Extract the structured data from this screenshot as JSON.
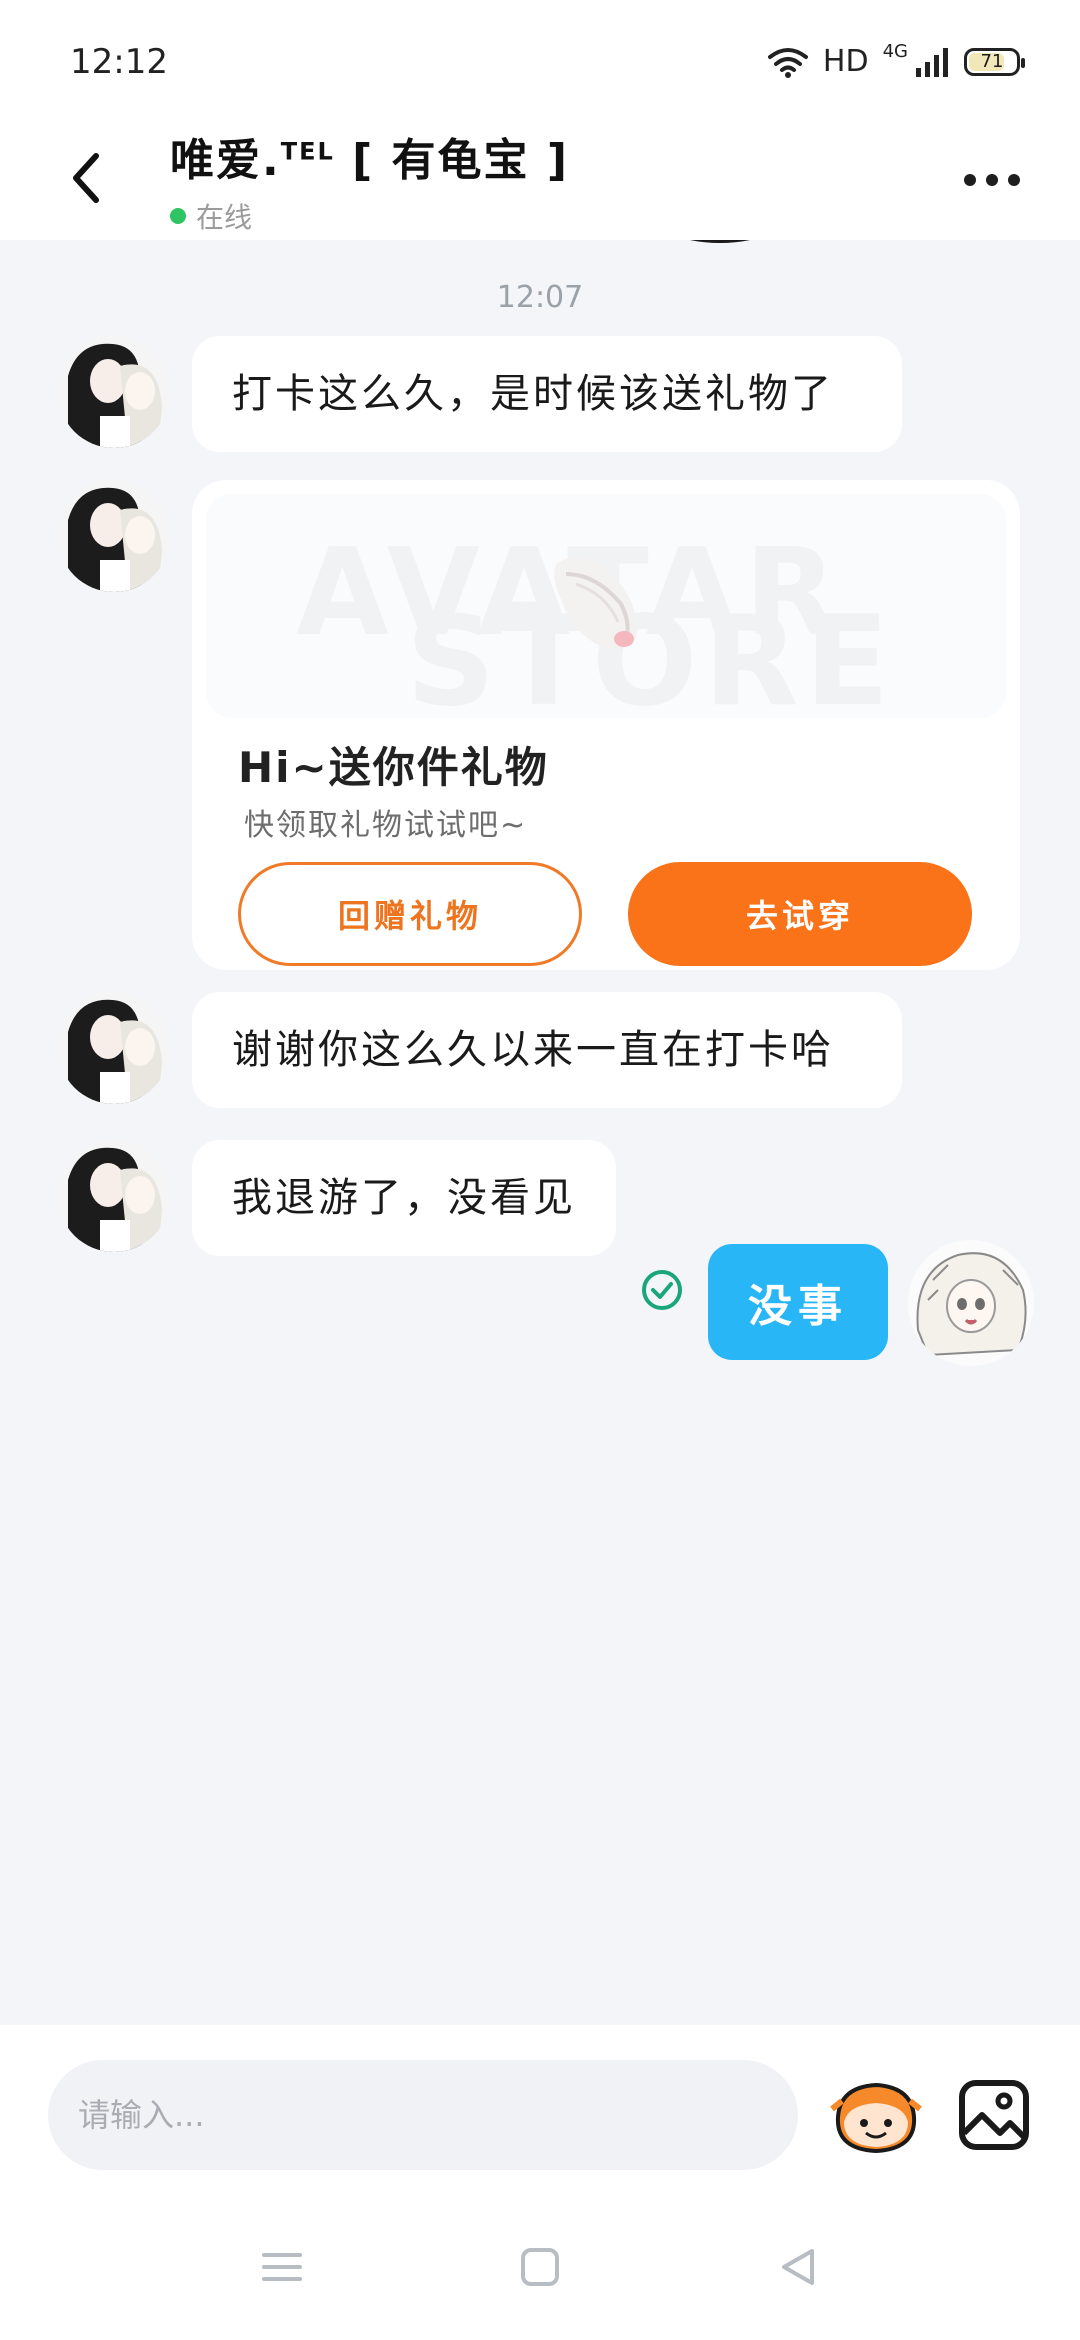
{
  "status_bar": {
    "time": "12:12",
    "hd": "HD",
    "network": "4G",
    "battery": "71"
  },
  "header": {
    "title": "唯爱.",
    "title_sup": "TEL",
    "title_suffix": " [ 有龟宝 ]",
    "status": "在线"
  },
  "chat": {
    "time_label": "12:07",
    "messages": [
      {
        "from": "other",
        "text": "打卡这么久，是时候该送礼物了"
      },
      {
        "from": "other",
        "text": "谢谢你这么久以来一直在打卡哈"
      },
      {
        "from": "other",
        "text": "我退游了，没看见"
      },
      {
        "from": "me",
        "text": "没事"
      }
    ],
    "gift_card": {
      "watermark_line1": "AVATAR",
      "watermark_line2": "STORE",
      "title": "Hi~送你件礼物",
      "subtitle": "快领取礼物试试吧~",
      "return_label": "回赠礼物",
      "try_label": "去试穿"
    }
  },
  "input": {
    "placeholder": "请输入..."
  },
  "colors": {
    "accent_orange": "#fa7319",
    "my_bubble": "#29b6f6",
    "check_green": "#1aa67a",
    "online_green": "#2fc463"
  },
  "icons": [
    "back-arrow-icon",
    "more-dots-icon",
    "check-circle-icon",
    "emoji-mascot-icon",
    "image-picker-icon",
    "nav-menu-icon",
    "nav-home-icon",
    "nav-back-icon"
  ]
}
